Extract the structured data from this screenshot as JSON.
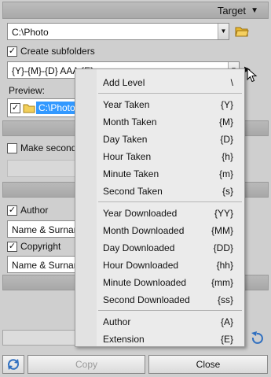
{
  "header": {
    "target_label": "Target"
  },
  "path": {
    "value": "C:\\Photo"
  },
  "create_subfolders": {
    "label": "Create subfolders",
    "checked": true
  },
  "pattern": {
    "value": "{Y}-{M}-{D} AAA {E}"
  },
  "preview": {
    "label": "Preview:",
    "folder": "C:\\Photo"
  },
  "make_second": {
    "label": "Make second"
  },
  "author": {
    "label": "Author",
    "checked": true,
    "value": "Name & Surnam"
  },
  "copyright": {
    "label": "Copyright",
    "checked": true,
    "value": "Name & Surnam"
  },
  "buttons": {
    "copy": "Copy",
    "close": "Close"
  },
  "menu": {
    "groups": [
      [
        {
          "label": "Add Level",
          "code": "\\"
        }
      ],
      [
        {
          "label": "Year Taken",
          "code": "{Y}"
        },
        {
          "label": "Month Taken",
          "code": "{M}"
        },
        {
          "label": "Day Taken",
          "code": "{D}"
        },
        {
          "label": "Hour Taken",
          "code": "{h}"
        },
        {
          "label": "Minute Taken",
          "code": "{m}"
        },
        {
          "label": "Second Taken",
          "code": "{s}"
        }
      ],
      [
        {
          "label": "Year Downloaded",
          "code": "{YY}"
        },
        {
          "label": "Month Downloaded",
          "code": "{MM}"
        },
        {
          "label": "Day Downloaded",
          "code": "{DD}"
        },
        {
          "label": "Hour Downloaded",
          "code": "{hh}"
        },
        {
          "label": "Minute Downloaded",
          "code": "{mm}"
        },
        {
          "label": "Second Downloaded",
          "code": "{ss}"
        }
      ],
      [
        {
          "label": "Author",
          "code": "{A}"
        },
        {
          "label": "Extension",
          "code": "{E}"
        }
      ]
    ]
  }
}
